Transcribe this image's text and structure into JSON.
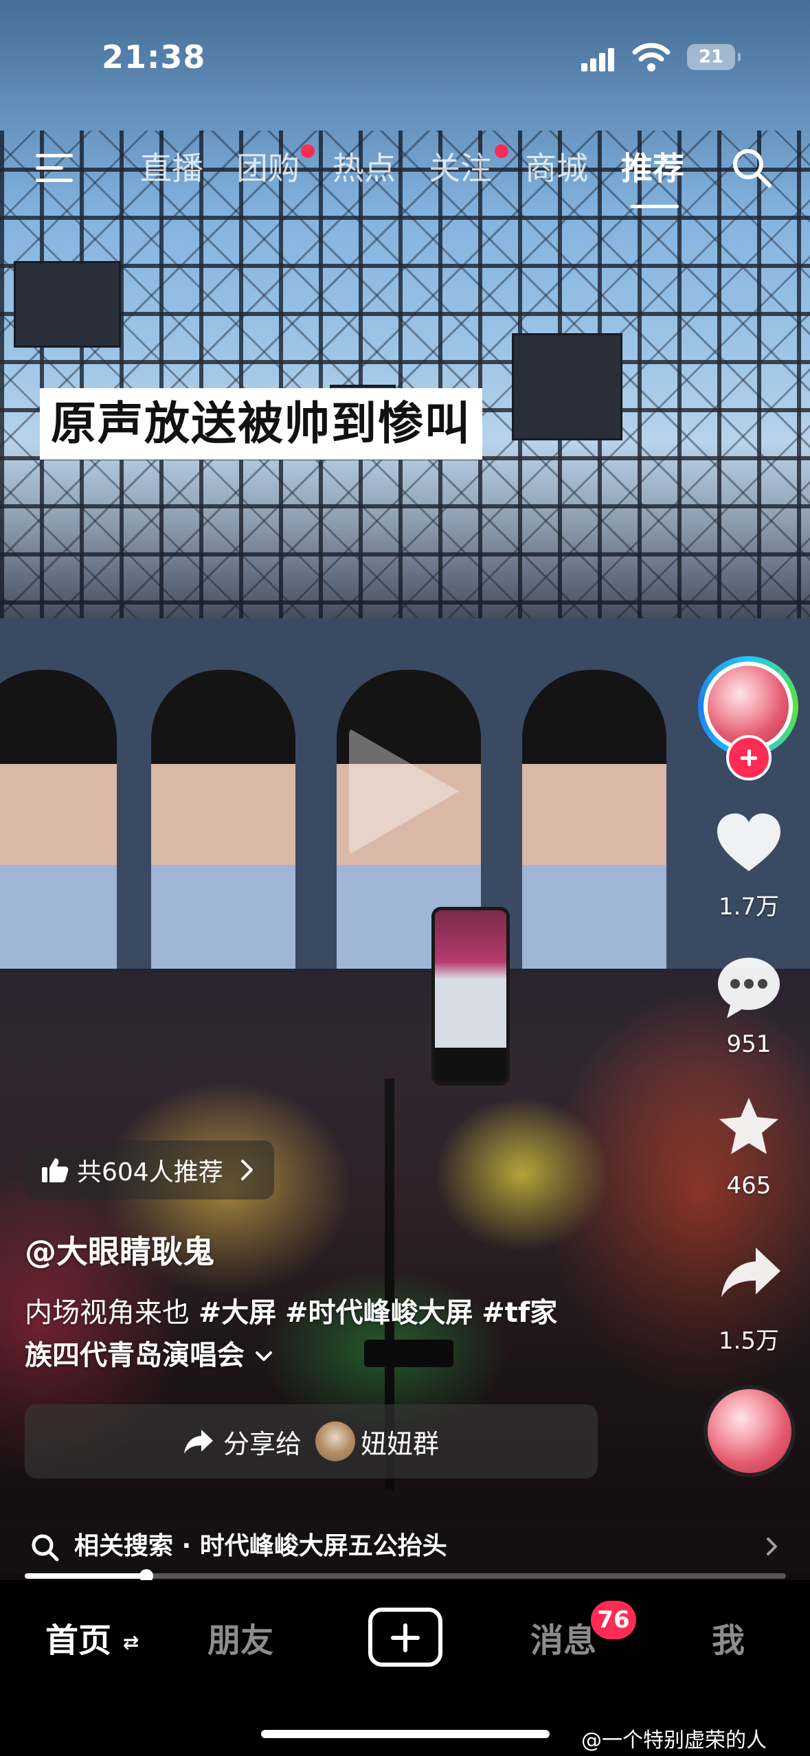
{
  "status_bar": {
    "time": "21:38",
    "battery_level": "21"
  },
  "top_nav": {
    "tabs": [
      {
        "label": "直播",
        "has_dot": false
      },
      {
        "label": "团购",
        "has_dot": true
      },
      {
        "label": "热点",
        "has_dot": false
      },
      {
        "label": "关注",
        "has_dot": true
      },
      {
        "label": "商城",
        "has_dot": false
      },
      {
        "label": "推荐",
        "has_dot": false,
        "active": true
      }
    ],
    "menu_icon": "menu-icon",
    "search_icon": "search-icon"
  },
  "video": {
    "overlay_caption": "原声放送被帅到惨叫"
  },
  "actions": {
    "likes": "1.7万",
    "comments": "951",
    "favorites": "465",
    "shares": "1.5万"
  },
  "info": {
    "recommend_text": "共604人推荐",
    "author": "@大眼睛耿鬼",
    "desc_prefix": "内场视角来也 ",
    "tag1": "#大屏",
    "tag2": "#时代峰峻大屏",
    "tag3": "#tf家",
    "desc_line2": "族四代青岛演唱会"
  },
  "share_bar": {
    "label": "分享给",
    "target": "妞妞群"
  },
  "related_search": {
    "text": "相关搜索 · 时代峰峻大屏五公抬头"
  },
  "progress": {
    "fraction": 0.16
  },
  "bottom_nav": {
    "home": "首页",
    "friends": "朋友",
    "messages": "消息",
    "messages_badge": "76",
    "me": "我"
  },
  "watermark": "@一个特别虚荣的人",
  "colors": {
    "accent": "#fe2c55",
    "avatar_ring": "#22c7f5"
  }
}
